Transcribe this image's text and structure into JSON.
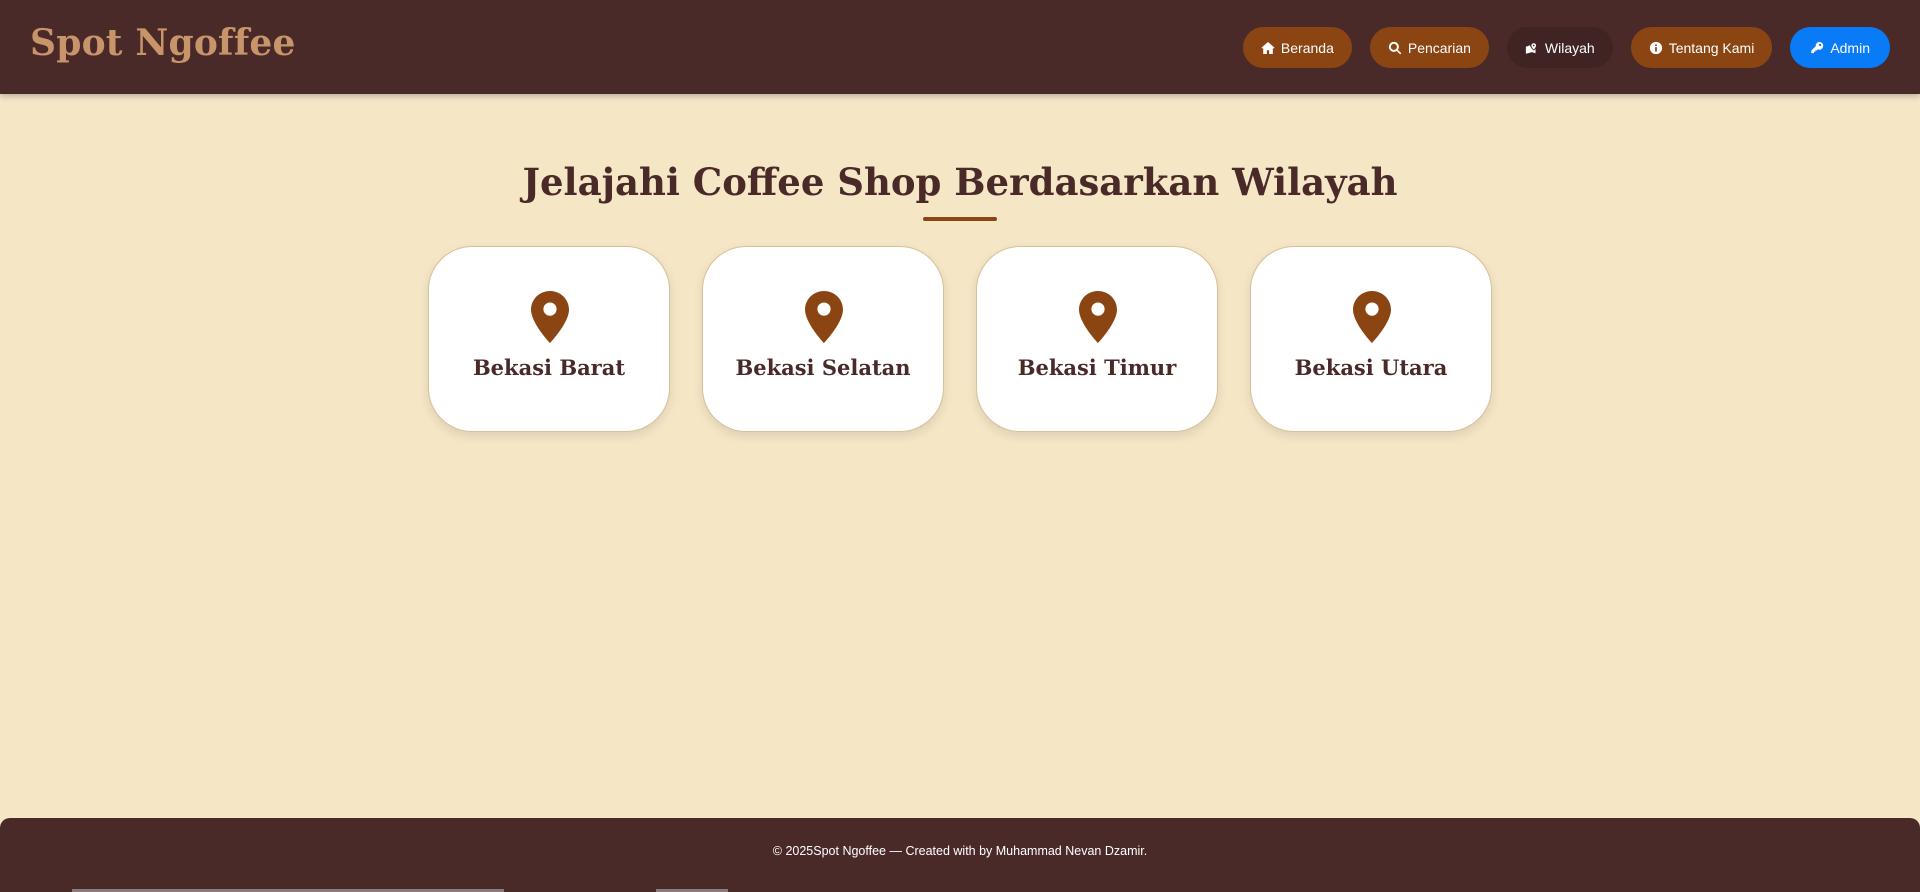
{
  "app": {
    "brand": "Spot Ngoffee"
  },
  "nav": {
    "items": [
      {
        "label": "Beranda",
        "icon": "home-icon"
      },
      {
        "label": "Pencarian",
        "icon": "search-icon"
      },
      {
        "label": "Wilayah",
        "icon": "map-icon",
        "active": true
      },
      {
        "label": "Tentang Kami",
        "icon": "info-icon"
      },
      {
        "label": "Admin",
        "icon": "key-icon"
      }
    ]
  },
  "main": {
    "title": "Jelajahi Coffee Shop Berdasarkan Wilayah",
    "regions": [
      {
        "label": "Bekasi Barat",
        "icon": "map-pin-icon"
      },
      {
        "label": "Bekasi Selatan",
        "icon": "map-pin-icon"
      },
      {
        "label": "Bekasi Timur",
        "icon": "map-pin-icon"
      },
      {
        "label": "Bekasi Utara",
        "icon": "map-pin-icon"
      }
    ]
  },
  "footer": {
    "text": "© 2025Spot Ngoffee — Created with by Muhammad Nevan Dzamir."
  },
  "colors": {
    "header_bg": "#4a2a29",
    "page_bg": "#f5e6c6",
    "accent": "#8b4513",
    "brand_text": "#c8946a",
    "admin_button": "#0a7bf7"
  }
}
